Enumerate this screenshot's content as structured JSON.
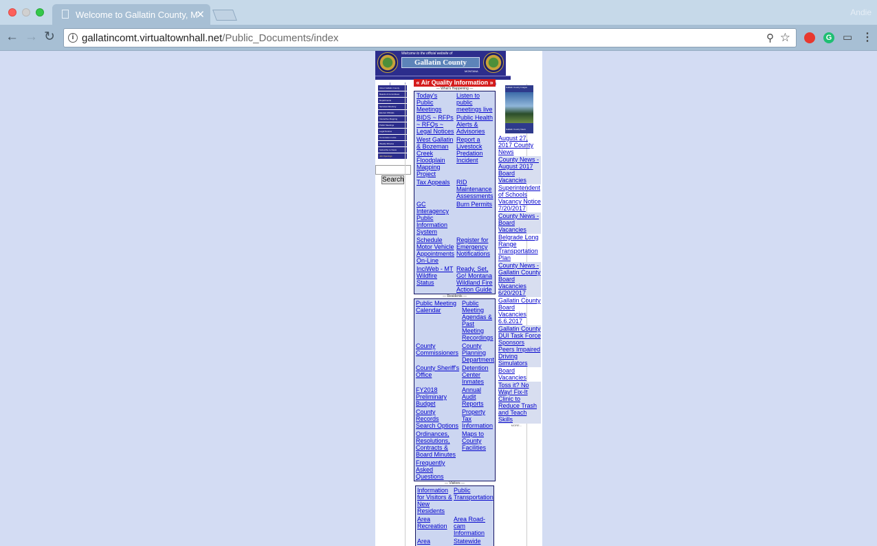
{
  "browser": {
    "tab_title": "Welcome to Gallatin County, M",
    "url_host": "gallatincomt.virtualtownhall.net",
    "url_path": "/Public_Documents/index",
    "user": "Andie"
  },
  "site": {
    "welcome": "Welcome to the official website of",
    "county_name": "Gallatin County",
    "state": "MONTANA",
    "air_quality": "Air Quality Information",
    "search_button": "Search",
    "left_nav": [
      "About Gallatin County",
      "Boards & Committees",
      "Departments",
      "Services Directory",
      "Elected Officials",
      "Interactive Mapping",
      "Public Meetings",
      "Legal Notices",
      "Commission Links",
      "Weekly Minutes",
      "Subscribe to News",
      "Job Openings"
    ],
    "thumb_caption_top": "Gallatin County Images",
    "thumb_caption_bottom": "Gallatin County News"
  },
  "whats_happening": {
    "title": "What's Happening",
    "links": [
      "Today's Public Meetings",
      "Listen to public meetings live",
      "BIDS ~ RFPs ~ RFQs ~ Legal Notices",
      "Public Health Alerts & Advisories",
      "West Gallatin & Bozeman Creek Floodplain Mapping Project",
      "Report a Livestock Predation Incident",
      "Tax Appeals",
      "RID Maintenance Assessments",
      "GC Interagency Public Information System",
      "Burn Permits",
      "Schedule Motor Vehicle Appointments On-Line",
      "Register for Emergency Notifications",
      "InciWeb - MT Wildfire Status",
      "Ready, Set, Go! Montana Wildland Fire Action Guide"
    ]
  },
  "residents": {
    "title": "Residents",
    "links": [
      "Public Meeting Calendar",
      "Public Meeting Agendas & Past Meeting Recordings",
      "County Commissioners",
      "County Planning Department",
      "County Sheriff's Office",
      "Detention Center Inmates",
      "FY2018 Preliminary Budget",
      "Annual Audit Reports",
      "County Records Search Options",
      "Property Tax Information",
      "Ordinances, Resolutions, Contracts & Board Minutes",
      "Maps to County Facilities",
      "Frequently Asked Questions"
    ]
  },
  "visitors": {
    "title": "Visitors",
    "links": [
      "Information for Visitors & New Residents",
      "Public Transportation",
      "Area Recreation",
      "Area Road-cam Information",
      "Area",
      "Statewide"
    ]
  },
  "news": [
    "August 27, 2017 County News",
    "County News - August 2017 Board Vacancies",
    "Superintendent of Schools Vacancy Notice 7/20/2017",
    "County News - Board Vacancies",
    "Belgrade Long Range Transportation Plan",
    "County News - Gallatin County Board Vacancies 6/20/2017",
    "Gallatin County Board Vacancies 6.6.2017",
    "Gallatin County DUI Task Force Sponsors Peers Impaired Driving Simulators",
    "Board Vacancies",
    "Toss it? No Way! Fix-It Clinic to Reduce Trash and Teach Skills"
  ],
  "news_more": "MORE..."
}
